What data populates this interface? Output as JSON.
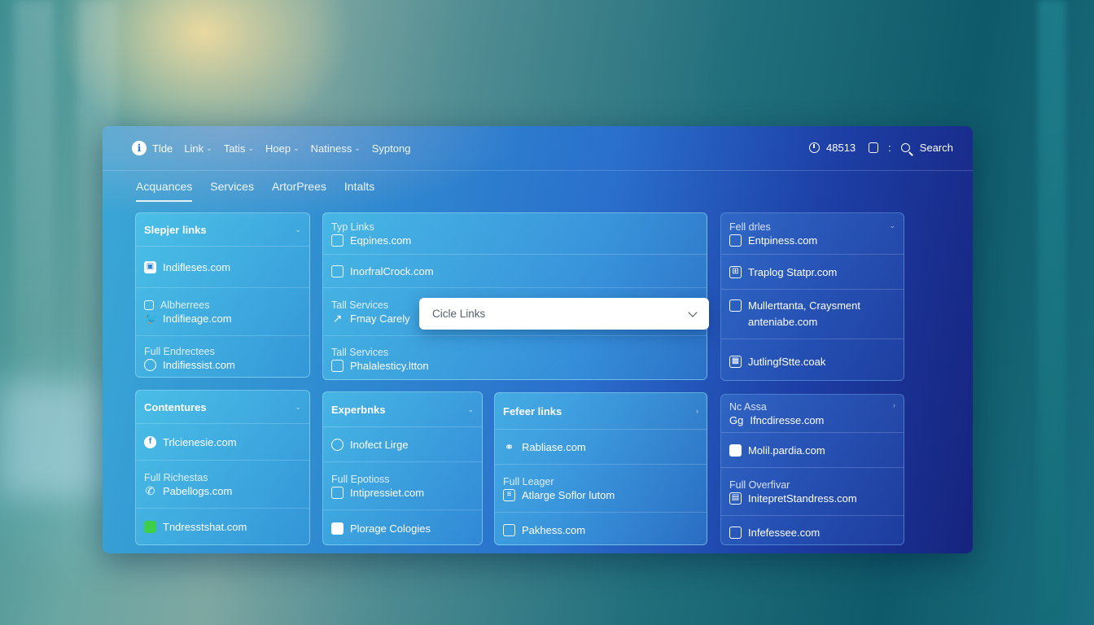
{
  "nav": {
    "brand": "Tlde",
    "items": [
      "Link",
      "Tatis",
      "Hoep",
      "Natiness"
    ],
    "last_item": "Syptong",
    "counter": "48513",
    "search_label": "Search"
  },
  "tabs": [
    "Acquances",
    "Services",
    "ArtorPrees",
    "Intalts"
  ],
  "cards": {
    "c1": {
      "title": "Slepjer links",
      "rows": [
        {
          "label": "",
          "link": "Indifleses.com",
          "icon": "lock-icon"
        },
        {
          "label": "Albherrees",
          "link": "Indifieage.com",
          "icon": "twitter-icon"
        },
        {
          "label": "Full Endrectees",
          "link": "Indifiessist.com",
          "icon": "location-pin-icon"
        }
      ]
    },
    "c2": {
      "title": "Typ Links",
      "rows": [
        {
          "label": "",
          "link": "Eqpines.com",
          "icon": "grid-icon"
        },
        {
          "label": "",
          "link": "InorfralCrock.com",
          "icon": "card-icon"
        },
        {
          "label": "Tall Services",
          "link": "Fmay Carely",
          "icon": "chart-icon"
        },
        {
          "label": "Tall Services",
          "link": "Phalalesticy.ltton",
          "icon": "building-icon"
        }
      ]
    },
    "c3": {
      "title": "Fell drles",
      "rows": [
        {
          "label": "",
          "link": "Entpiness.com",
          "icon": "mail-icon"
        },
        {
          "label": "",
          "link": "Traplog Statpr.com",
          "icon": "window-icon"
        },
        {
          "label": "",
          "link": "Mullerttanta, Craysment anteniabe.com",
          "icon": "document-icon"
        },
        {
          "label": "",
          "link": "JutlingfStte.coak",
          "icon": "calculator-icon"
        }
      ]
    },
    "c4": {
      "title": "Contentures",
      "rows": [
        {
          "label": "",
          "link": "Trlcienesie.com",
          "icon": "facebook-icon"
        },
        {
          "label": "Full Richestas",
          "link": "Pabellogs.com",
          "icon": "phone-icon"
        },
        {
          "label": "",
          "link": "Tndresstshat.com",
          "icon": "chat-icon"
        }
      ]
    },
    "c5": {
      "title": "Experbnks",
      "rows": [
        {
          "label": "",
          "link": "Inofect Lirge",
          "icon": "users-icon"
        },
        {
          "label": "Full Epotioss",
          "link": "Intipressiet.com",
          "icon": "grid-icon"
        },
        {
          "label": "",
          "link": "Plorage Cologies",
          "icon": "file-icon"
        }
      ]
    },
    "c6": {
      "title": "Fefeer links",
      "rows": [
        {
          "label": "",
          "link": "Rabliase.com",
          "icon": "share-icon"
        },
        {
          "label": "Full Leager",
          "link": "Atlarge Soflor lutom",
          "icon": "list-icon"
        },
        {
          "label": "",
          "link": "Pakhess.com",
          "icon": "message-icon"
        }
      ]
    },
    "c7": {
      "title": "Nc Assa",
      "sub": "Gg",
      "rows": [
        {
          "label": "",
          "link": "Molil.pardia.com",
          "icon": "folder-icon"
        },
        {
          "label": "Full Overfivar",
          "link": "InitepretStandress.com",
          "icon": "table-icon"
        },
        {
          "label": "",
          "link": "Infefessee.com",
          "icon": "mail-icon"
        }
      ]
    }
  },
  "c7_head_link": "Ifncdiresse.com",
  "dropdown": {
    "value": "Cicle Links"
  },
  "colors": {
    "panel_start": "#3aa7d6",
    "panel_end": "#16237e",
    "dropdown_bg": "#ffffff"
  }
}
